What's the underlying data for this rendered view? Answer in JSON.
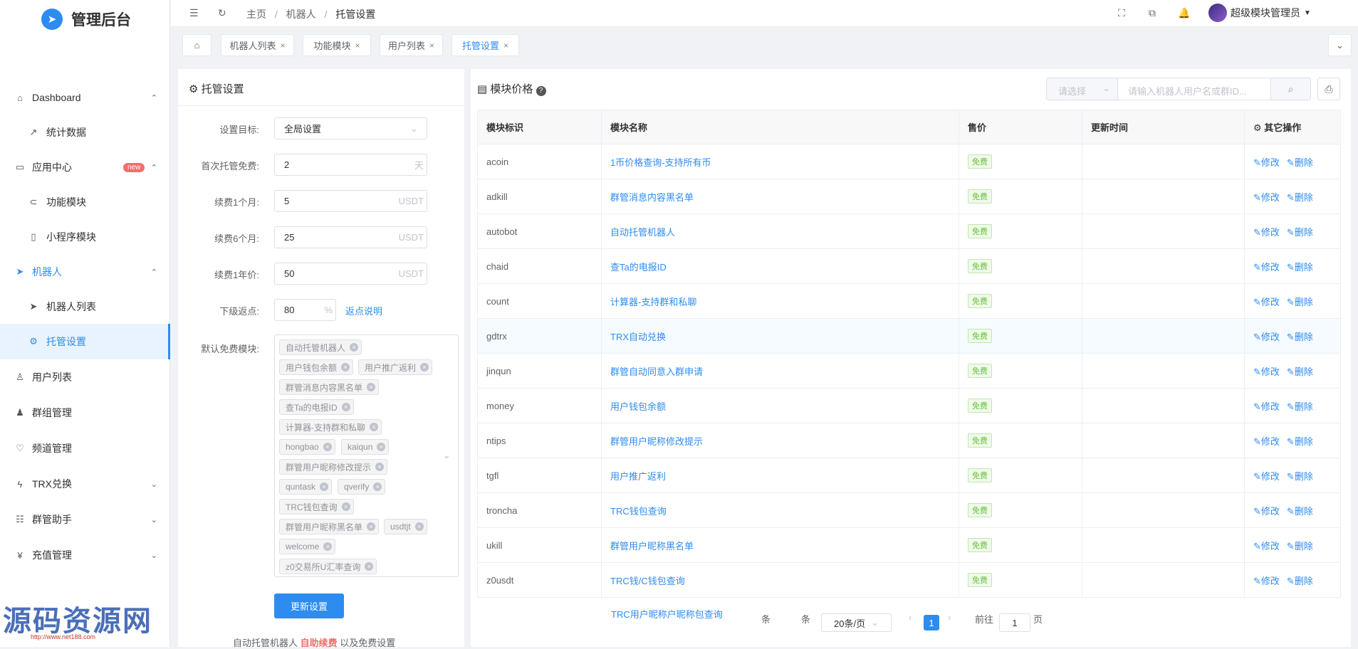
{
  "brand": {
    "title": "管理后台"
  },
  "sidebar": {
    "items": [
      {
        "label": "Dashboard",
        "icon": "home-icon"
      },
      {
        "label": "统计数据",
        "icon": "chart-line-icon"
      },
      {
        "label": "应用中心",
        "icon": "app-icon",
        "badge": "new"
      },
      {
        "label": "功能模块",
        "icon": "toggle-icon"
      },
      {
        "label": "小程序模块",
        "icon": "mobile-icon"
      },
      {
        "label": "机器人",
        "icon": "paper-plane-icon"
      },
      {
        "label": "机器人列表",
        "icon": "paper-plane-icon"
      },
      {
        "label": "托管设置",
        "icon": "gears-icon"
      },
      {
        "label": "用户列表",
        "icon": "user-icon"
      },
      {
        "label": "群组管理",
        "icon": "users-icon"
      },
      {
        "label": "频道管理",
        "icon": "heart-icon"
      },
      {
        "label": "TRX兑换",
        "icon": "bolt-icon"
      },
      {
        "label": "群管助手",
        "icon": "sliders-icon"
      },
      {
        "label": "充值管理",
        "icon": "yen-icon"
      }
    ]
  },
  "header": {
    "breadcrumb": [
      "主页",
      "机器人",
      "托管设置"
    ],
    "user": "超级模块管理员"
  },
  "tabs": [
    "机器人列表",
    "功能模块",
    "用户列表",
    "托管设置"
  ],
  "settings": {
    "title": "托管设置",
    "target_label": "设置目标:",
    "target_value": "全局设置",
    "first_free_label": "首次托管免费:",
    "first_free_value": "2",
    "first_free_unit": "天",
    "renew1_label": "续费1个月:",
    "renew1_value": "5",
    "renew6_label": "续费6个月:",
    "renew6_value": "25",
    "renew12_label": "续费1年价:",
    "renew12_value": "50",
    "unit": "USDT",
    "rebate_label": "下级返点:",
    "rebate_value": "80",
    "rebate_unit": "%",
    "rebate_link": "返点说明",
    "modules_label": "默认免费模块:",
    "chips": [
      "自动托管机器人",
      "用户钱包余额",
      "用户推广返利",
      "群管消息内容黑名单",
      "查Ta的电报ID",
      "计算器-支持群和私聊",
      "hongbao",
      "kaiqun",
      "群管用户昵称修改提示",
      "quntask",
      "qverify",
      "TRC钱包查询",
      "群管用户昵称黑名单",
      "usdtjt",
      "welcome",
      "z0交易所U汇率查询"
    ],
    "submit": "更新设置",
    "footer_a": "自动托管机器人",
    "footer_b": "自助续费",
    "footer_c": "以及免费设置"
  },
  "prices": {
    "title": "模块价格",
    "select_placeholder": "请选择",
    "search_placeholder": "请输入机器人用户名或群ID...",
    "columns": [
      "模块标识",
      "模块名称",
      "售价",
      "更新时间",
      "其它操作"
    ],
    "rows": [
      {
        "id": "acoin",
        "name": "1币价格查询-支持所有币",
        "price": "免费"
      },
      {
        "id": "adkill",
        "name": "群管消息内容黑名单",
        "price": "免费"
      },
      {
        "id": "autobot",
        "name": "自动托管机器人",
        "price": "免费"
      },
      {
        "id": "chaid",
        "name": "查Ta的电报ID",
        "price": "免费"
      },
      {
        "id": "count",
        "name": "计算器-支持群和私聊",
        "price": "免费"
      },
      {
        "id": "gdtrx",
        "name": "TRX自动兑换",
        "price": "免费"
      },
      {
        "id": "jinqun",
        "name": "群管自动同意入群申请",
        "price": "免费"
      },
      {
        "id": "money",
        "name": "用户钱包余额",
        "price": "免费"
      },
      {
        "id": "ntips",
        "name": "群管用户昵称修改提示",
        "price": "免费"
      },
      {
        "id": "tgfl",
        "name": "用户推广返利",
        "price": "免费"
      },
      {
        "id": "troncha",
        "name": "TRC钱包查询",
        "price": "免费"
      },
      {
        "id": "ukill",
        "name": "群管用户昵称黑名单",
        "price": "免费"
      },
      {
        "id": "z0usdt",
        "name": "TRC钱/C钱包查询",
        "price": "免费"
      }
    ],
    "edit": "修改",
    "delete": "删除",
    "overflow_name": "TRC用户昵称户昵称包查询",
    "pager": {
      "total_prefix": "条",
      "total_suffix": "条",
      "per_page": "20条/页",
      "current": "1",
      "goto": "前往",
      "goto_value": "1",
      "page_unit": "页"
    }
  },
  "watermark": {
    "text": "源码资源网",
    "url": "http://www.net188.com"
  }
}
